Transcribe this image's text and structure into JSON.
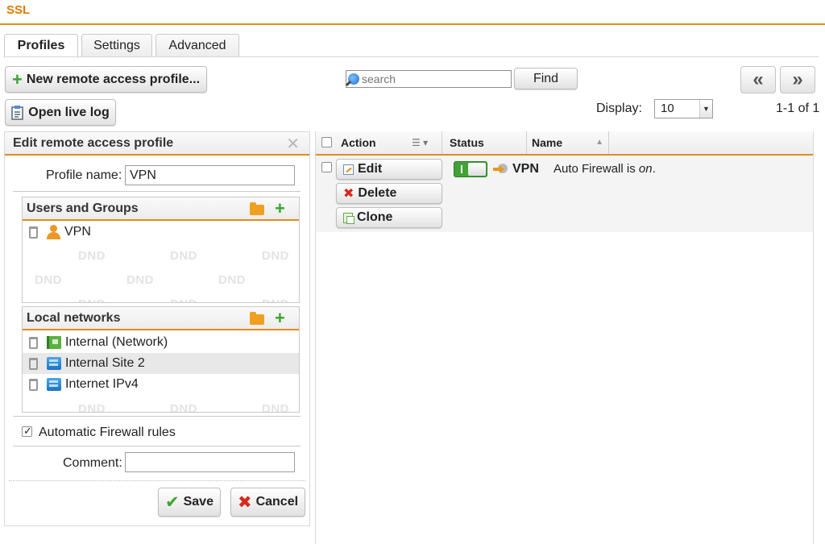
{
  "header": {
    "title": "SSL"
  },
  "tabs": [
    {
      "label": "Profiles"
    },
    {
      "label": "Settings"
    },
    {
      "label": "Advanced"
    }
  ],
  "toolbar": {
    "new_profile_label": "New remote access profile...",
    "open_log_label": "Open live log",
    "search_placeholder": "search",
    "find_label": "Find",
    "prev_label": "«",
    "next_label": "»",
    "display_label": "Display:",
    "display_value": "10",
    "pagination": "1-1 of 1"
  },
  "edit_panel": {
    "title": "Edit remote access profile",
    "profile_name_label": "Profile name:",
    "profile_name_value": "VPN",
    "users_groups": {
      "title": "Users and Groups",
      "items": [
        {
          "label": "VPN"
        }
      ],
      "dnd": "DND"
    },
    "local_networks": {
      "title": "Local networks",
      "items": [
        {
          "label": "Internal (Network)"
        },
        {
          "label": "Internal Site 2"
        },
        {
          "label": "Internet IPv4"
        }
      ],
      "dnd": "DND"
    },
    "auto_firewall_label": "Automatic Firewall rules",
    "auto_firewall_checked": true,
    "comment_label": "Comment:",
    "comment_value": "",
    "save_label": "Save",
    "cancel_label": "Cancel"
  },
  "grid": {
    "columns": {
      "action": "Action",
      "status": "Status",
      "name": "Name"
    },
    "rows": [
      {
        "edit_label": "Edit",
        "delete_label": "Delete",
        "clone_label": "Clone",
        "enabled": true,
        "name": "VPN",
        "description_prefix": "Auto Firewall is ",
        "description_state": "on",
        "description_suffix": "."
      }
    ]
  },
  "colors": {
    "accent": "#e38b1d",
    "title": "#e07b00",
    "toggle_on": "#41a235"
  }
}
